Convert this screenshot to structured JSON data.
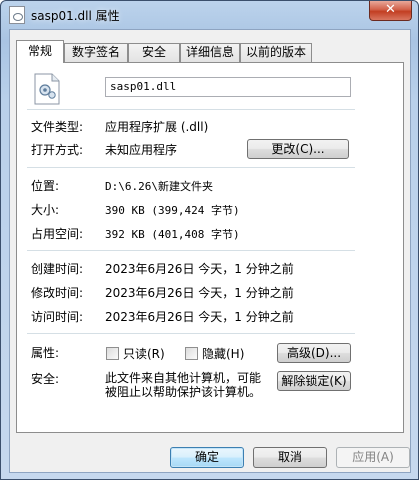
{
  "window": {
    "title": "sasp01.dll 属性",
    "close_label": "✕"
  },
  "tabs": [
    {
      "label": "常规"
    },
    {
      "label": "数字签名"
    },
    {
      "label": "安全"
    },
    {
      "label": "详细信息"
    },
    {
      "label": "以前的版本"
    }
  ],
  "general": {
    "filename": "sasp01.dll",
    "type_label": "文件类型:",
    "type_value": "应用程序扩展 (.dll)",
    "open_label": "打开方式:",
    "open_value": "未知应用程序",
    "change_button": "更改(C)...",
    "location_label": "位置:",
    "location_value": "D:\\6.26\\新建文件夹",
    "size_label": "大小:",
    "size_value": "390 KB (399,424 字节)",
    "disk_size_label": "占用空间:",
    "disk_size_value": "392 KB (401,408 字节)",
    "created_label": "创建时间:",
    "created_value": "2023年6月26日 今天，1 分钟之前",
    "modified_label": "修改时间:",
    "modified_value": "2023年6月26日 今天，1 分钟之前",
    "accessed_label": "访问时间:",
    "accessed_value": "2023年6月26日 今天，1 分钟之前",
    "attributes_label": "属性:",
    "readonly_label": "只读(R)",
    "hidden_label": "隐藏(H)",
    "advanced_button": "高级(D)...",
    "security_label": "安全:",
    "security_text_1": "此文件来自其他计算机，可能",
    "security_text_2": "被阻止以帮助保护该计算机。",
    "unblock_button": "解除锁定(K)"
  },
  "footer": {
    "ok": "确定",
    "cancel": "取消",
    "apply": "应用(A)"
  }
}
